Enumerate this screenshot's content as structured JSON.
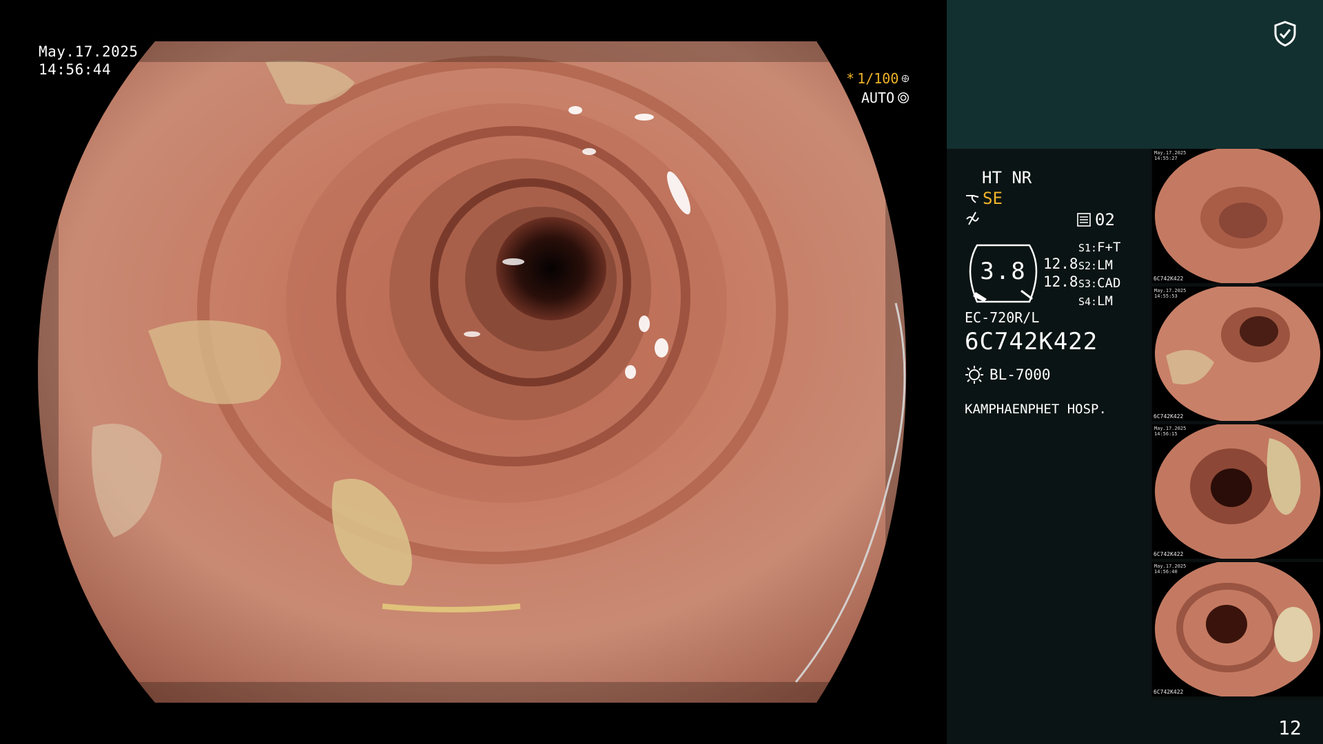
{
  "overlay": {
    "date": "May.17.2025",
    "time": "14:56:44",
    "shutter_mark": "*",
    "shutter": "1/100",
    "iris": "AUTO"
  },
  "panel": {
    "ht_nr": "HT NR",
    "se": "SE",
    "mode": "02",
    "zoom": "3.8",
    "num1": "12.8",
    "num2": "12.8",
    "switches": [
      {
        "key": "S1:",
        "val": "F+T"
      },
      {
        "key": "S2:",
        "val": "LM"
      },
      {
        "key": "S3:",
        "val": "CAD"
      },
      {
        "key": "S4:",
        "val": "LM"
      }
    ],
    "scope_model": "EC-720R/L",
    "scope_serial": "6C742K422",
    "light_source": "BL-7000",
    "hospital": "KAMPHAENPHET HOSP."
  },
  "thumbs": [
    {
      "date": "May.17.2025",
      "time": "14:55:27",
      "caption": "6C742K422"
    },
    {
      "date": "May.17.2025",
      "time": "14:55:53",
      "caption": "6C742K422"
    },
    {
      "date": "May.17.2025",
      "time": "14:56:15",
      "caption": "6C742K422"
    },
    {
      "date": "May.17.2025",
      "time": "14:56:40",
      "caption": "6C742K422"
    }
  ],
  "page_number": "12",
  "colors": {
    "accent": "#f0b429",
    "panel_top": "#12302f",
    "panel_side": "#0b1414"
  }
}
